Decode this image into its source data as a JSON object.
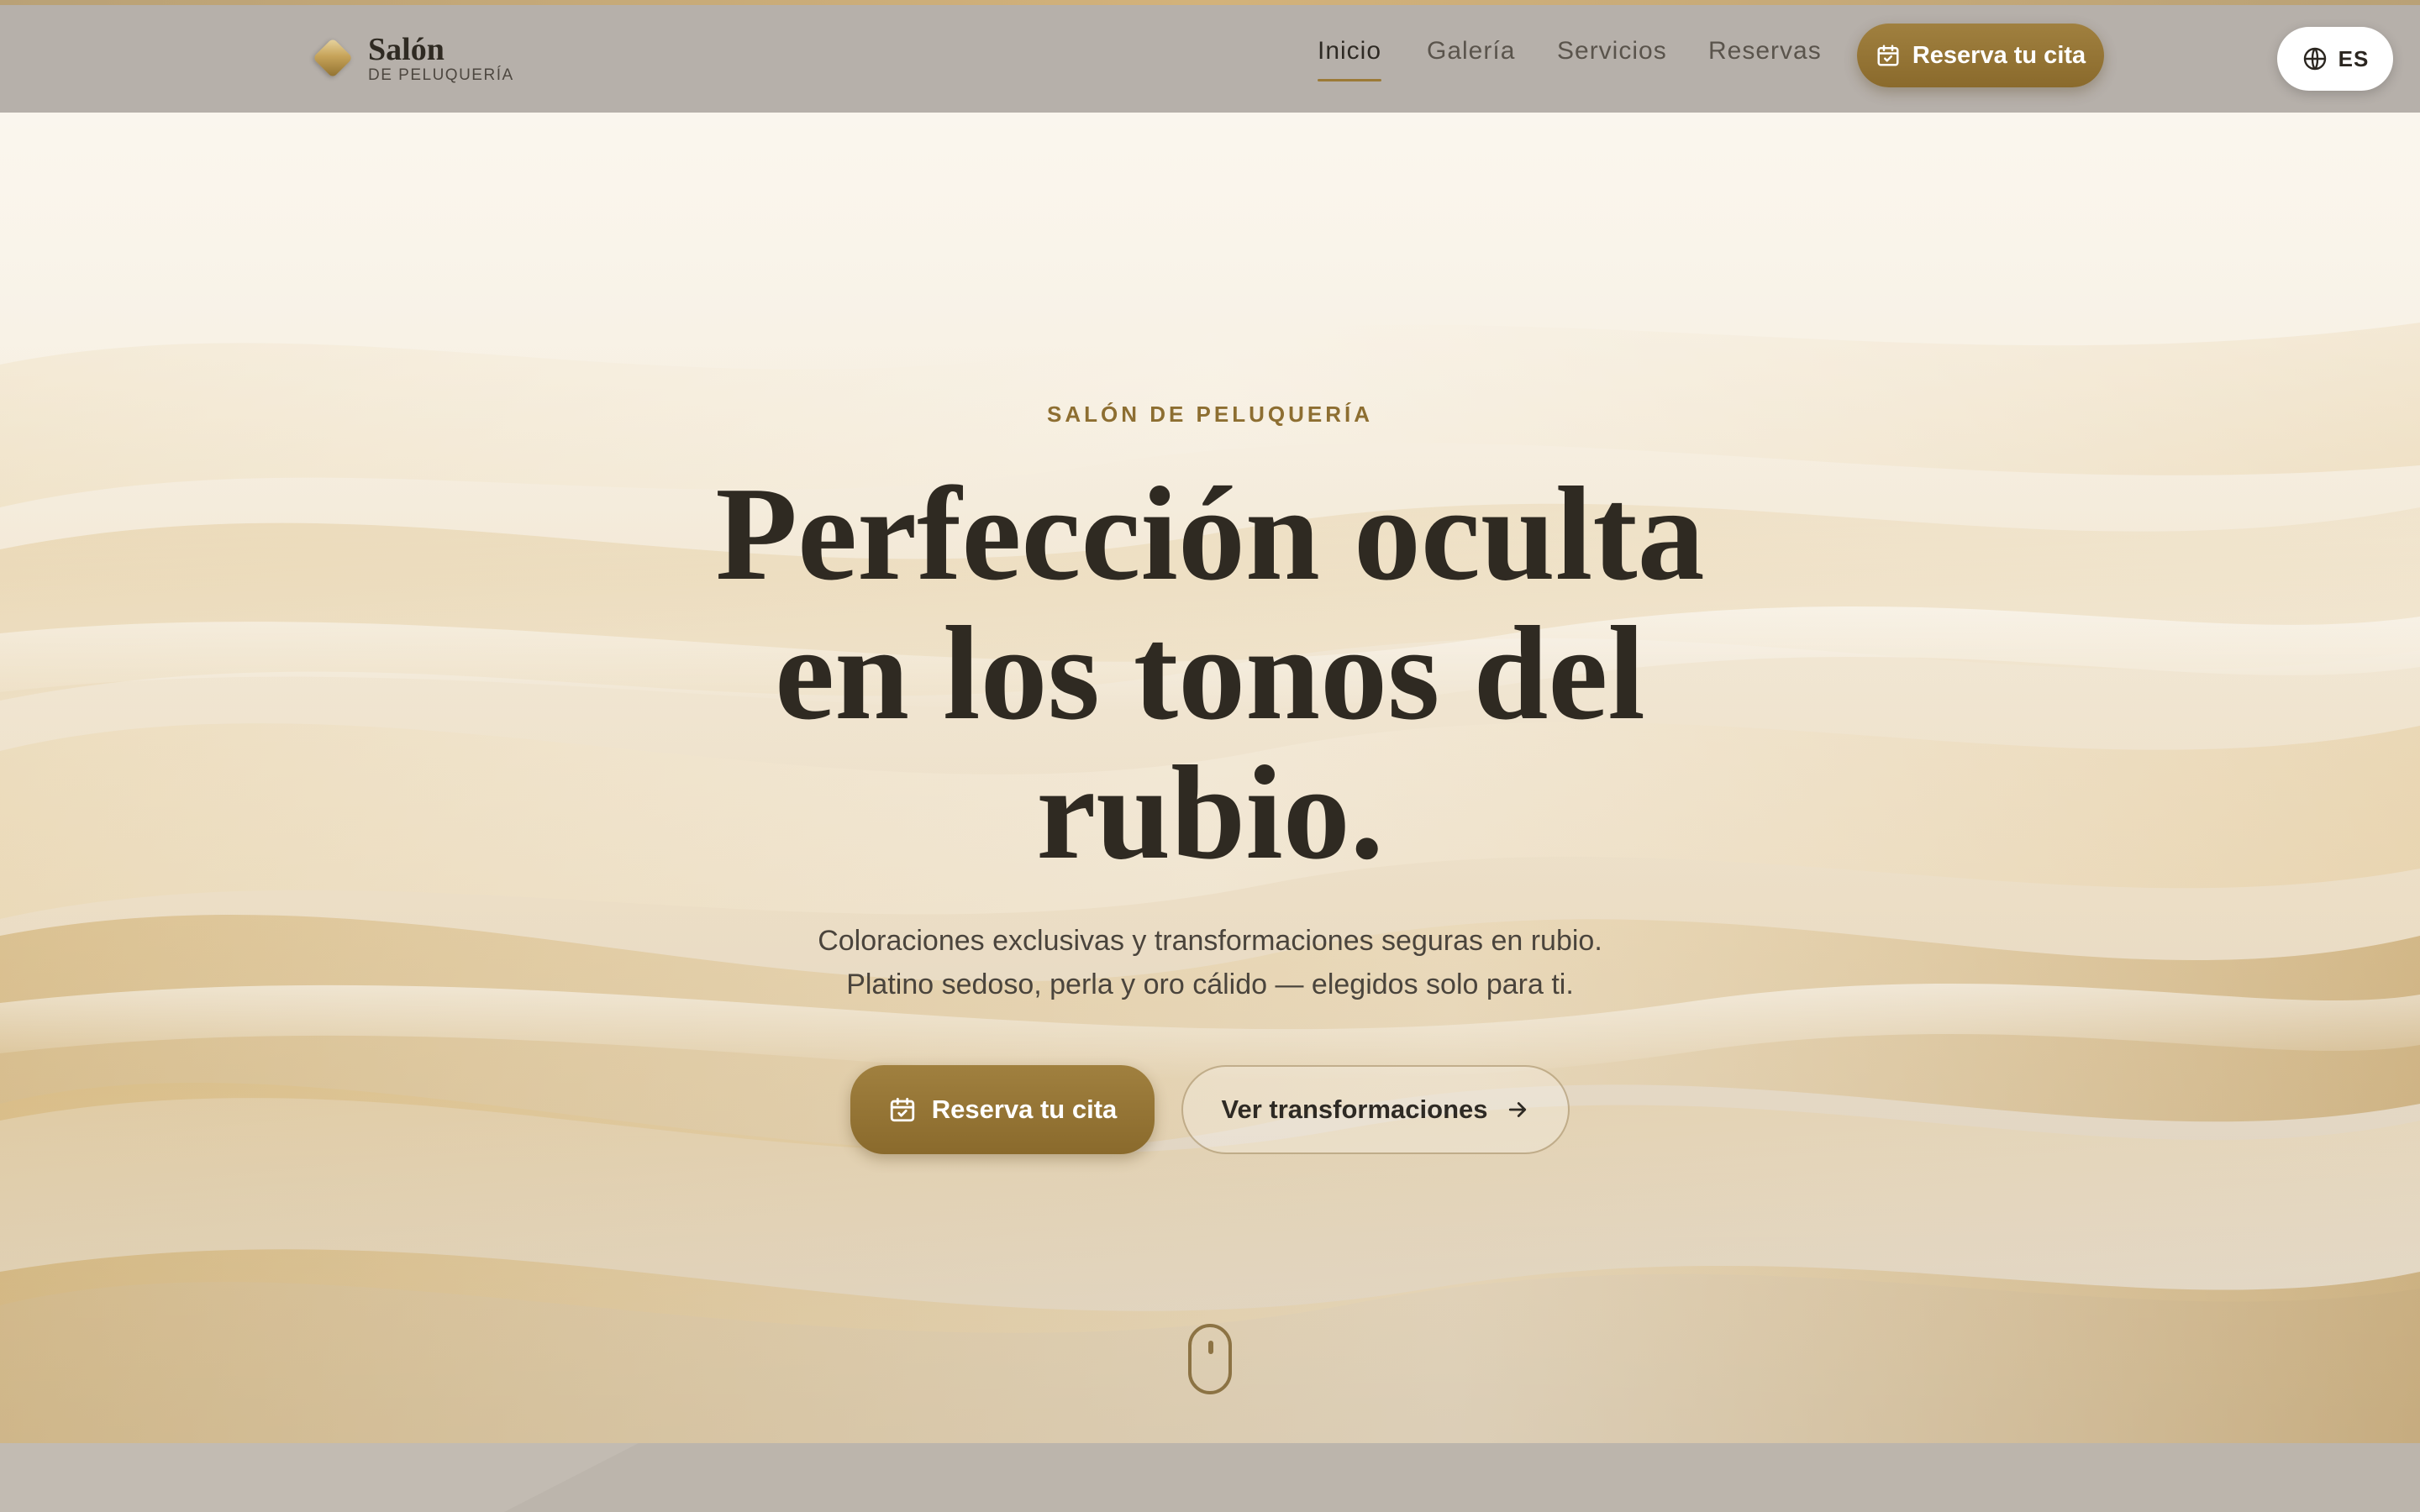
{
  "brand": {
    "title": "Salón",
    "subtitle": "DE PELUQUERÍA"
  },
  "nav": {
    "items": [
      {
        "label": "Inicio",
        "active": true
      },
      {
        "label": "Galería",
        "active": false
      },
      {
        "label": "Servicios",
        "active": false
      },
      {
        "label": "Reservas",
        "active": false
      }
    ],
    "cta_label": "Reserva tu cita"
  },
  "language": {
    "icon": "globe-icon",
    "code": "ES"
  },
  "hero": {
    "eyebrow": "SALÓN DE PELUQUERÍA",
    "headline_lines": [
      "Perfección oculta",
      "en los tonos del",
      "rubio."
    ],
    "subtitle_lines": [
      "Coloraciones exclusivas y transformaciones seguras en rubio.",
      "Platino sedoso, perla y oro cálido — elegidos solo para ti."
    ],
    "primary_cta": "Reserva tu cita",
    "secondary_cta": "Ver transformaciones"
  },
  "icons": {
    "calendar": "calendar-check-icon",
    "arrow": "arrow-right-icon",
    "scroll": "mouse-scroll-icon"
  },
  "colors": {
    "accent_gold": "#93743a",
    "text_dark": "#2f2a22",
    "eyebrow": "#8d6e31",
    "header_bg": "#b6b0aa"
  }
}
